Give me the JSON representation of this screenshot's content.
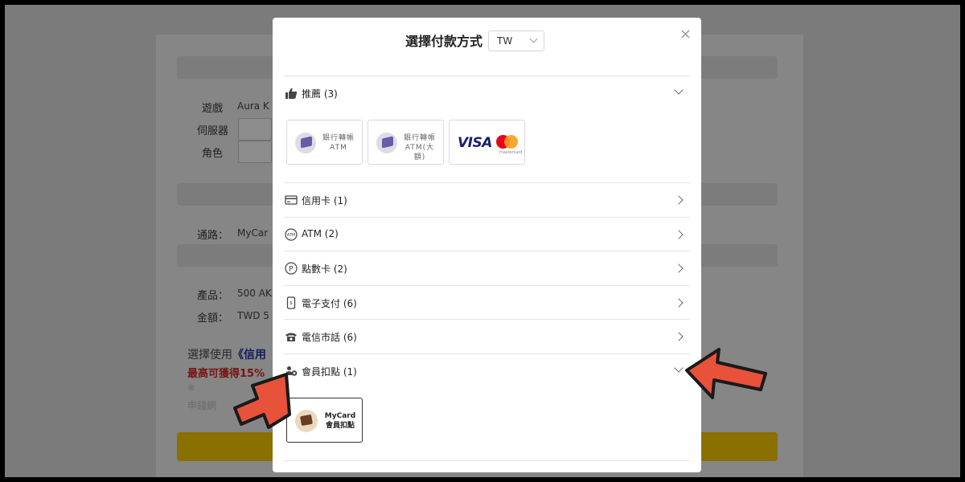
{
  "background": {
    "labels": {
      "game": "遊戲",
      "server": "伺服器",
      "role": "角色",
      "channel": "通路：",
      "product": "產品：",
      "amount": "金額："
    },
    "values": {
      "game": "Aura K",
      "channel": "MyCar",
      "product": "500 AK",
      "amount": "TWD 5"
    },
    "notice_prefix": "選擇使用",
    "notice_highlight": "《信用",
    "notice_red": "最高可獲得15%",
    "notice_gray1": "※",
    "notice_gray2": "申錢網"
  },
  "modal": {
    "title": "選擇付款方式",
    "region": "TW",
    "close": "×",
    "recommended": {
      "label": "推薦 (3)",
      "icon": "thumbs-up-icon",
      "tiles": [
        {
          "line1": "銀行轉帳",
          "line2": "ATM"
        },
        {
          "line1": "銀行轉帳",
          "line2": "ATM(大額)"
        },
        {
          "visa": "VISA",
          "mc": "mastercard"
        }
      ]
    },
    "categories": [
      {
        "label": "信用卡 (1)",
        "icon": "credit-card-icon"
      },
      {
        "label": "ATM (2)",
        "icon": "atm-icon"
      },
      {
        "label": "點數卡 (2)",
        "icon": "points-card-icon"
      },
      {
        "label": "電子支付 (6)",
        "icon": "mobile-payment-icon"
      },
      {
        "label": "電信市話 (6)",
        "icon": "telephone-icon"
      },
      {
        "label": "會員扣點 (1)",
        "icon": "member-points-icon"
      }
    ],
    "member_tile": {
      "line1": "MyCard",
      "line2": "會員扣點"
    }
  },
  "colors": {
    "accent_arrow": "#e8523a",
    "submit_bg": "#8a7000"
  }
}
